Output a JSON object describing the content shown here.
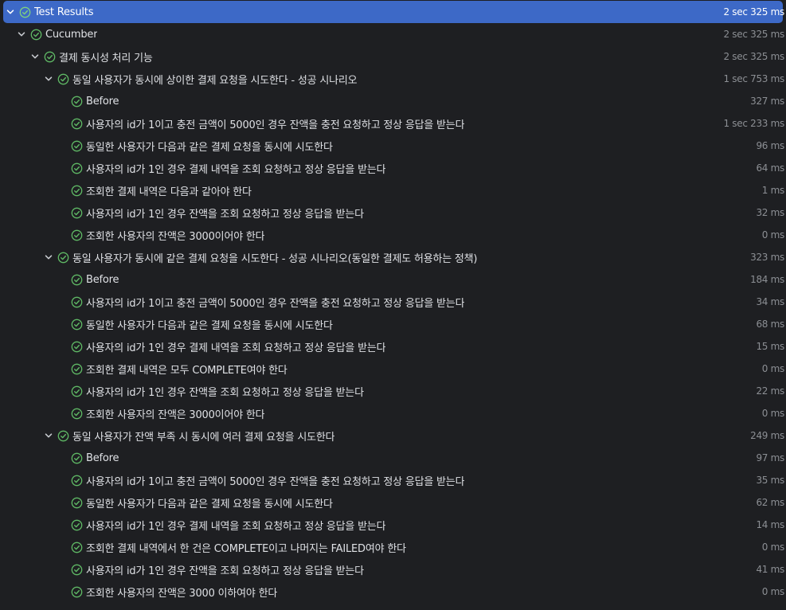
{
  "colors": {
    "background": "#1e1f22",
    "selection": "#3d69c7",
    "pass_green": "#5fb865",
    "text": "#dfe1e5",
    "duration": "#8c8f94"
  },
  "icons": {
    "expand": "chevron-down-icon",
    "status": "check-circle-icon"
  },
  "root": {
    "label": "Test Results",
    "duration": "2 sec 325 ms"
  },
  "suite": {
    "label": "Cucumber",
    "duration": "2 sec 325 ms"
  },
  "feature": {
    "label": "결제 동시성 처리 기능",
    "duration": "2 sec 325 ms"
  },
  "scenarios": [
    {
      "label": "동일 사용자가 동시에 상이한 결제 요청을 시도한다 - 성공 시나리오",
      "duration": "1 sec 753 ms",
      "steps": [
        {
          "label": "Before",
          "duration": "327 ms"
        },
        {
          "label": "사용자의 id가 1이고 충전 금액이 5000인 경우 잔액을 충전 요청하고 정상 응답을 받는다",
          "duration": "1 sec 233 ms"
        },
        {
          "label": "동일한 사용자가 다음과 같은 결제 요청을 동시에 시도한다",
          "duration": "96 ms"
        },
        {
          "label": "사용자의 id가 1인 경우 결제 내역을 조회 요청하고 정상 응답을 받는다",
          "duration": "64 ms"
        },
        {
          "label": "조회한 결제 내역은 다음과 같아야 한다",
          "duration": "1 ms"
        },
        {
          "label": "사용자의 id가 1인 경우 잔액을 조회 요청하고 정상 응답을 받는다",
          "duration": "32 ms"
        },
        {
          "label": "조회한 사용자의 잔액은 3000이어야 한다",
          "duration": "0 ms"
        }
      ]
    },
    {
      "label": "동일 사용자가 동시에 같은 결제 요청을 시도한다 - 성공 시나리오(동일한 결제도 허용하는 정책)",
      "duration": "323 ms",
      "steps": [
        {
          "label": "Before",
          "duration": "184 ms"
        },
        {
          "label": "사용자의 id가 1이고 충전 금액이 5000인 경우 잔액을 충전 요청하고 정상 응답을 받는다",
          "duration": "34 ms"
        },
        {
          "label": "동일한 사용자가 다음과 같은 결제 요청을 동시에 시도한다",
          "duration": "68 ms"
        },
        {
          "label": "사용자의 id가 1인 경우 결제 내역을 조회 요청하고 정상 응답을 받는다",
          "duration": "15 ms"
        },
        {
          "label": "조회한 결제 내역은 모두 COMPLETE여야 한다",
          "duration": "0 ms"
        },
        {
          "label": "사용자의 id가 1인 경우 잔액을 조회 요청하고 정상 응답을 받는다",
          "duration": "22 ms"
        },
        {
          "label": "조회한 사용자의 잔액은 3000이어야 한다",
          "duration": "0 ms"
        }
      ]
    },
    {
      "label": "동일 사용자가 잔액 부족 시 동시에 여러 결제 요청을 시도한다",
      "duration": "249 ms",
      "steps": [
        {
          "label": "Before",
          "duration": "97 ms"
        },
        {
          "label": "사용자의 id가 1이고 충전 금액이 5000인 경우 잔액을 충전 요청하고 정상 응답을 받는다",
          "duration": "35 ms"
        },
        {
          "label": "동일한 사용자가 다음과 같은 결제 요청을 동시에 시도한다",
          "duration": "62 ms"
        },
        {
          "label": "사용자의 id가 1인 경우 결제 내역을 조회 요청하고 정상 응답을 받는다",
          "duration": "14 ms"
        },
        {
          "label": "조회한 결제 내역에서 한 건은 COMPLETE이고 나머지는 FAILED여야 한다",
          "duration": "0 ms"
        },
        {
          "label": "사용자의 id가 1인 경우 잔액을 조회 요청하고 정상 응답을 받는다",
          "duration": "41 ms"
        },
        {
          "label": "조회한 사용자의 잔액은 3000 이하여야 한다",
          "duration": "0 ms"
        }
      ]
    }
  ]
}
